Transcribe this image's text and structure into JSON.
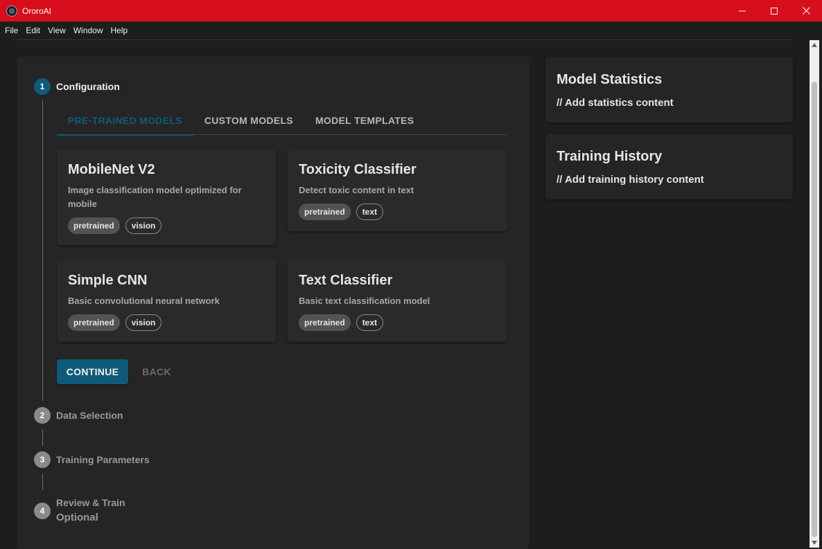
{
  "window": {
    "title": "OroroAI",
    "controls": {
      "minimize": "—",
      "maximize": "☐",
      "close": "✕"
    }
  },
  "menu": [
    "File",
    "Edit",
    "View",
    "Window",
    "Help"
  ],
  "stepper": {
    "steps": [
      {
        "number": "1",
        "label": "Configuration",
        "active": true
      },
      {
        "number": "2",
        "label": "Data Selection",
        "active": false
      },
      {
        "number": "3",
        "label": "Training Parameters",
        "active": false
      },
      {
        "number": "4",
        "label": "Review & Train",
        "sublabel": "Optional",
        "active": false
      }
    ]
  },
  "tabs": [
    {
      "label": "PRE-TRAINED MODELS",
      "active": true
    },
    {
      "label": "CUSTOM MODELS",
      "active": false
    },
    {
      "label": "MODEL TEMPLATES",
      "active": false
    }
  ],
  "models": [
    {
      "title": "MobileNet V2",
      "description": "Image classification model optimized for mobile",
      "tags": [
        "pretrained",
        "vision"
      ]
    },
    {
      "title": "Toxicity Classifier",
      "description": "Detect toxic content in text",
      "tags": [
        "pretrained",
        "text"
      ]
    },
    {
      "title": "Simple CNN",
      "description": "Basic convolutional neural network",
      "tags": [
        "pretrained",
        "vision"
      ]
    },
    {
      "title": "Text Classifier",
      "description": "Basic text classification model",
      "tags": [
        "pretrained",
        "text"
      ]
    }
  ],
  "actions": {
    "continue": "CONTINUE",
    "back": "BACK"
  },
  "side": {
    "stats": {
      "title": "Model Statistics",
      "body": "// Add statistics content"
    },
    "history": {
      "title": "Training History",
      "body": "// Add training history content"
    }
  },
  "colors": {
    "titlebar": "#d70f1c",
    "accent": "#0f5a7a",
    "background": "#1d1d1d",
    "panel": "#252525"
  }
}
